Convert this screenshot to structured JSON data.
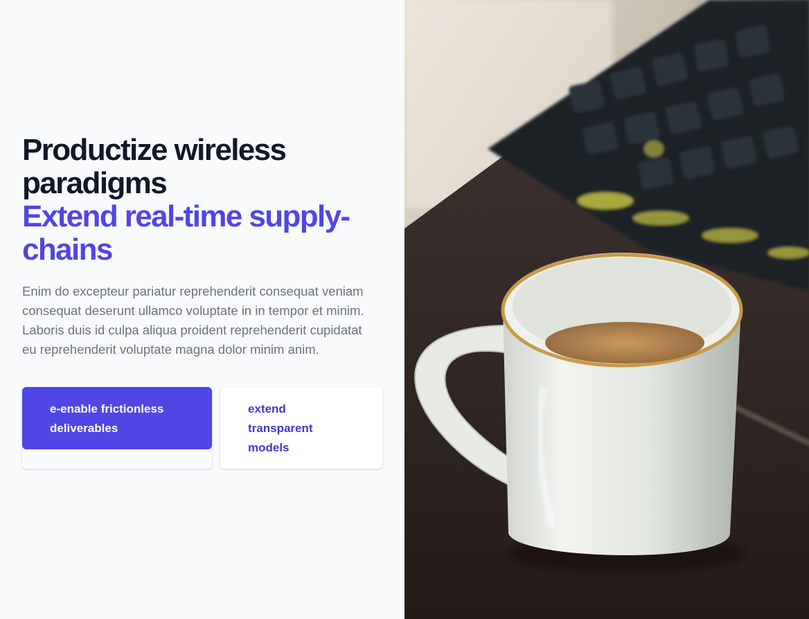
{
  "hero": {
    "title_line1": "Productize wireless paradigms",
    "title_line2": "Extend real-time supply-chains",
    "description": "Enim do excepteur pariatur reprehenderit consequat veniam consequat deserunt ullamco voluptate in in tempor et minim. Laboris duis id culpa aliqua proident reprehenderit cupidatat eu reprehenderit voluptate magna dolor minim anim.",
    "primary_button": "e-enable frictionless deliverables",
    "secondary_button": "extend transparent models"
  },
  "colors": {
    "accent": "#4f46e5",
    "heading": "#111827",
    "body_text": "#6b7280",
    "background": "#f8fafc"
  },
  "image": {
    "subject": "coffee-cup-and-keyboard-photo"
  }
}
